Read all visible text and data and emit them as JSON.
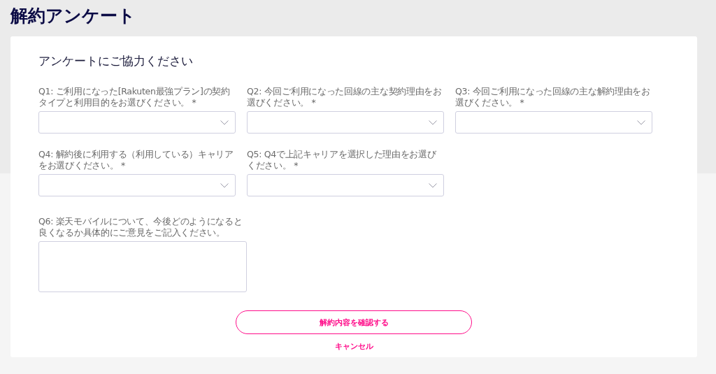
{
  "page_title": "解約アンケート",
  "survey": {
    "heading": "アンケートにご協力ください",
    "questions": [
      {
        "kind": "select",
        "label": "Q1: ご利用になった[Rakuten最強プラン]の契約タイプと利用目的をお選びください。 *"
      },
      {
        "kind": "select",
        "label": "Q2: 今回ご利用になった回線の主な契約理由をお選びください。 *"
      },
      {
        "kind": "select",
        "label": "Q3: 今回ご利用になった回線の主な解約理由をお選びください。 *"
      },
      {
        "kind": "select",
        "label": "Q4: 解約後に利用する（利用している）キャリアをお選びください。 *"
      },
      {
        "kind": "select",
        "label": "Q5: Q4で上記キャリアを選択した理由をお選びください。 *"
      },
      {
        "kind": "textarea",
        "label": "Q6: 楽天モバイルについて、今後どのようになると良くなるか具体的にご意見をご記入ください。"
      }
    ],
    "confirm_button": "解約内容を確認する",
    "cancel_link": "キャンセル"
  }
}
